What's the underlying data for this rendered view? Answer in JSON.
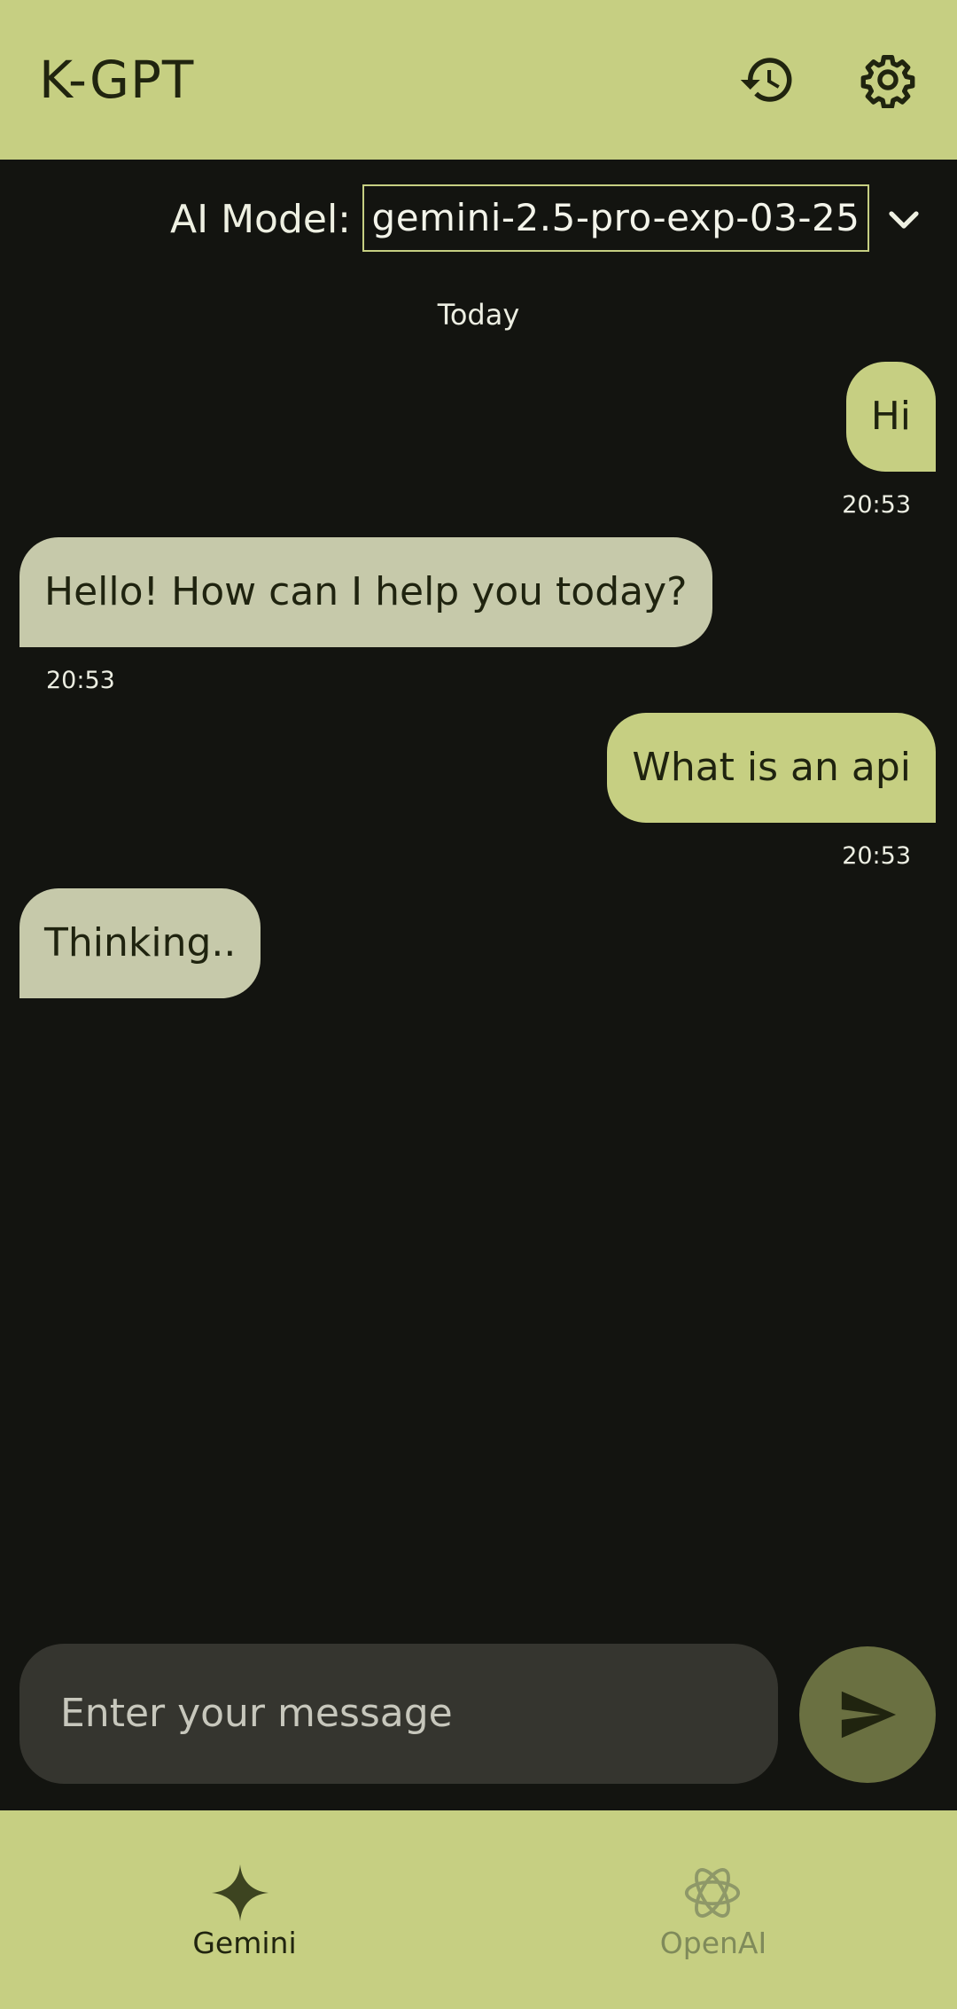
{
  "header": {
    "app_title": "K-GPT",
    "history_icon": "history-icon",
    "settings_icon": "gear-icon"
  },
  "model_selector": {
    "label": "AI Model:",
    "selected": "gemini-2.5-pro-exp-03-25",
    "dropdown_icon": "chevron-down-icon"
  },
  "chat": {
    "date_separator": "Today",
    "messages": [
      {
        "role": "user",
        "text": "Hi",
        "time": "20:53"
      },
      {
        "role": "bot",
        "text": "Hello! How can I help you today?",
        "time": "20:53"
      },
      {
        "role": "user",
        "text": "What is an api",
        "time": "20:53"
      },
      {
        "role": "bot",
        "text": "Thinking.."
      }
    ]
  },
  "composer": {
    "placeholder": "Enter your message",
    "send_icon": "send-icon"
  },
  "bottom_nav": {
    "items": [
      {
        "label": "Gemini",
        "icon": "gemini-sparkle-icon",
        "selected": true
      },
      {
        "label": "OpenAI",
        "icon": "openai-logo-icon",
        "selected": false
      }
    ]
  },
  "colors": {
    "accent": "#c6cf82",
    "background": "#131410",
    "bot_bubble": "#c6c9aa",
    "input_bg": "#35352f",
    "send_button": "#6a7041"
  }
}
